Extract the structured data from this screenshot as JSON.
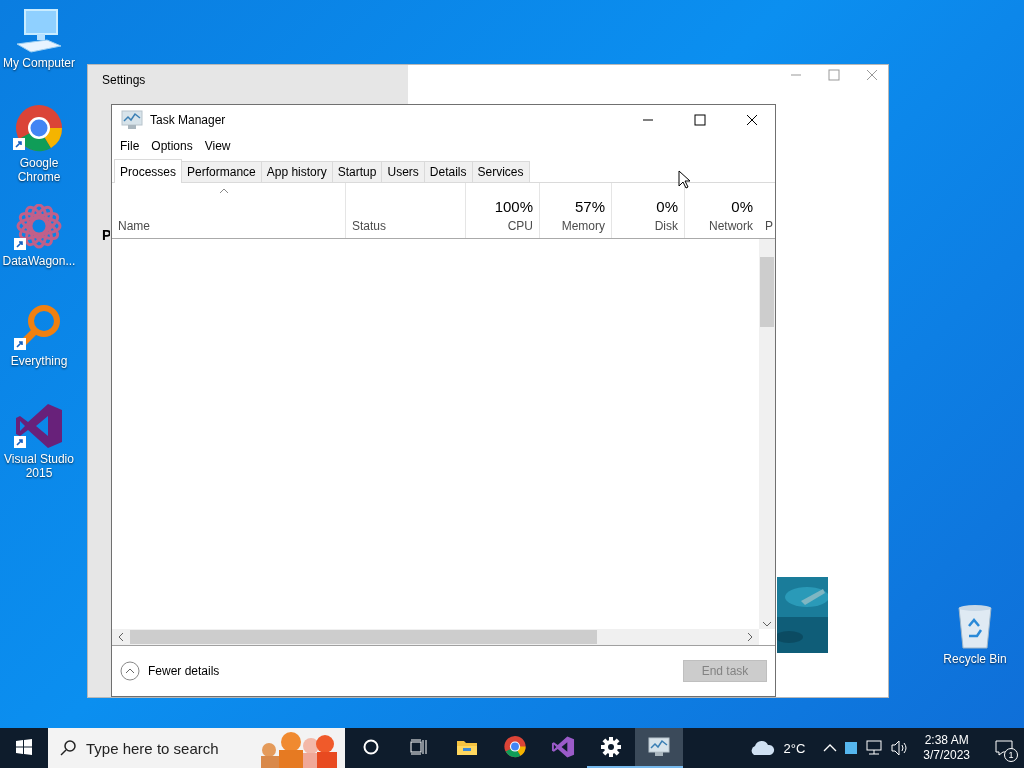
{
  "desktop_icons": [
    {
      "kind": "computer",
      "label": "My Computer"
    },
    {
      "kind": "chrome",
      "label": "Google Chrome"
    },
    {
      "kind": "datawagon",
      "label": "DataWagon..."
    },
    {
      "kind": "everything",
      "label": "Everything"
    },
    {
      "kind": "visualstudio",
      "label": "Visual Studio 2015"
    },
    {
      "kind": "recyclebin",
      "label": "Recycle Bin"
    }
  ],
  "settings_window": {
    "title": "Settings",
    "sidebar_letter": "P"
  },
  "task_manager": {
    "title": "Task Manager",
    "menu": [
      "File",
      "Options",
      "View"
    ],
    "tabs": [
      {
        "label": "Processes",
        "selected": true
      },
      {
        "label": "Performance",
        "selected": false
      },
      {
        "label": "App history",
        "selected": false
      },
      {
        "label": "Startup",
        "selected": false
      },
      {
        "label": "Users",
        "selected": false
      },
      {
        "label": "Details",
        "selected": false
      },
      {
        "label": "Services",
        "selected": false
      }
    ],
    "columns": [
      {
        "label": "Name"
      },
      {
        "label": "Status"
      },
      {
        "label": "CPU",
        "reading": "100%"
      },
      {
        "label": "Memory",
        "reading": "57%"
      },
      {
        "label": "Disk",
        "reading": "0%"
      },
      {
        "label": "Network",
        "reading": "0%"
      },
      {
        "label": "P"
      }
    ],
    "details_toggle": "Fewer details",
    "end_task": {
      "label": "End task",
      "disabled": true
    }
  },
  "taskbar": {
    "search_placeholder": "Type here to search",
    "apps": [
      {
        "kind": "cortana",
        "running": false,
        "selected": false
      },
      {
        "kind": "taskview",
        "running": false,
        "selected": false
      },
      {
        "kind": "explorer",
        "running": false,
        "selected": false
      },
      {
        "kind": "chrome",
        "running": false,
        "selected": false
      },
      {
        "kind": "visualstudio",
        "running": false,
        "selected": false
      },
      {
        "kind": "settings",
        "running": true,
        "selected": false
      },
      {
        "kind": "taskmanager",
        "running": true,
        "selected": true
      }
    ],
    "weather": "2°C",
    "time": "2:38 AM",
    "date": "3/7/2023",
    "notifications": "1"
  }
}
